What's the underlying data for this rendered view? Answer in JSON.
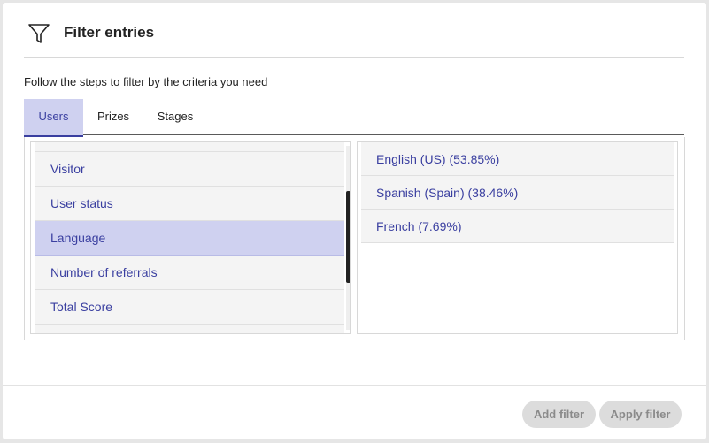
{
  "header": {
    "icon": "funnel-filter-icon",
    "title": "Filter entries"
  },
  "subtitle": "Follow the steps to filter by the criteria you need",
  "tabs": [
    {
      "label": "Users",
      "active": true
    },
    {
      "label": "Prizes",
      "active": false
    },
    {
      "label": "Stages",
      "active": false
    }
  ],
  "criteria": {
    "items": [
      {
        "label": "Visitor",
        "selected": false
      },
      {
        "label": "User status",
        "selected": false
      },
      {
        "label": "Language",
        "selected": true
      },
      {
        "label": "Number of referrals",
        "selected": false
      },
      {
        "label": "Total Score",
        "selected": false
      }
    ]
  },
  "values": {
    "items": [
      {
        "label": "English (US) (53.85%)"
      },
      {
        "label": "Spanish (Spain) (38.46%)"
      },
      {
        "label": "French (7.69%)"
      }
    ]
  },
  "footer": {
    "add_filter_label": "Add filter",
    "apply_filter_label": "Apply filter"
  },
  "colors": {
    "accent": "#3a3fa0",
    "selected_bg": "#cfd1f0",
    "disabled_button_bg": "#dcdcdc"
  }
}
